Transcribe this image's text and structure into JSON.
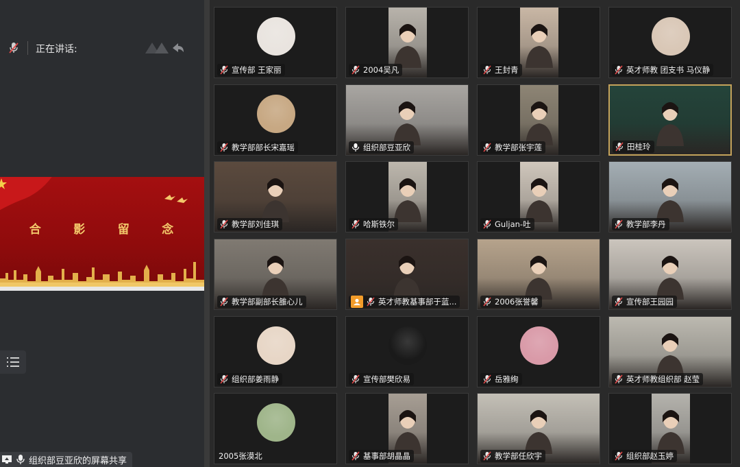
{
  "speaking": {
    "label": "正在讲话:"
  },
  "share_preview": {
    "title_chars": [
      "合",
      "影",
      "留",
      "念"
    ]
  },
  "share_status": {
    "text": "组织部豆亚欣的屏幕共享"
  },
  "colors": {
    "tile_bg": "#1c1c1c",
    "mic_muted": "#e04848",
    "host_badge": "#f39c2a",
    "banner_red": "#a40f10",
    "banner_gold": "#f3c86b"
  },
  "participants": [
    {
      "name": "宣传部 王家丽",
      "mic": "muted",
      "view": "avatar",
      "avatar_color": "#e9e4df"
    },
    {
      "name": "2004吴凡",
      "mic": "muted",
      "view": "video",
      "bg": "#b8b3ab"
    },
    {
      "name": "王封青",
      "mic": "muted",
      "view": "video",
      "bg": "#c9b7a5"
    },
    {
      "name": "英才师教 团支书 马仪静",
      "mic": "muted",
      "view": "avatar",
      "avatar_color": "#d9c7b6"
    },
    {
      "name": "教学部部长宋嘉瑶",
      "mic": "muted",
      "view": "avatar",
      "avatar_color": "#c7a883"
    },
    {
      "name": "组织部豆亚欣",
      "mic": "on",
      "view": "video",
      "bg": "#a9a6a2"
    },
    {
      "name": "教学部张宇莲",
      "mic": "muted",
      "view": "video",
      "bg": "#8e8575"
    },
    {
      "name": "田桂玲",
      "mic": "muted",
      "view": "video",
      "bg": "#24443a",
      "active": true
    },
    {
      "name": "教学部刘佳琪",
      "mic": "muted",
      "view": "video",
      "bg": "#5b4a3e"
    },
    {
      "name": "哈斯铁尔",
      "mic": "muted",
      "view": "video",
      "bg": "#bdb7ad"
    },
    {
      "name": "Guljan-吐",
      "mic": "muted",
      "view": "video",
      "bg": "#d0c7bc"
    },
    {
      "name": "教学部李丹",
      "mic": "muted",
      "view": "video",
      "bg": "#a4aeb4"
    },
    {
      "name": "教学部副部长雒心儿",
      "mic": "muted",
      "view": "video",
      "bg": "#807a72"
    },
    {
      "name": "英才师教基事部于蓝...",
      "mic": "muted",
      "view": "video",
      "bg": "#3a302c",
      "host": true
    },
    {
      "name": "2006张誉馨",
      "mic": "muted",
      "view": "video",
      "bg": "#b6a38c"
    },
    {
      "name": "宣传部王园园",
      "mic": "muted",
      "view": "video",
      "bg": "#cbc5bd"
    },
    {
      "name": "组织部姜雨静",
      "mic": "muted",
      "view": "avatar",
      "avatar_color": "#e7d6c6"
    },
    {
      "name": "宣传部樊欣易",
      "mic": "muted",
      "view": "avatar",
      "avatar_color": "#1a1a1a"
    },
    {
      "name": "岳雅绚",
      "mic": "muted",
      "view": "avatar",
      "avatar_color": "#d99aa8"
    },
    {
      "name": "英才师教组织部 赵莹",
      "mic": "muted",
      "view": "video",
      "bg": "#bcb9b0"
    },
    {
      "name": "2005张漠北",
      "mic": "none",
      "view": "avatar",
      "avatar_color": "#9fb58a"
    },
    {
      "name": "基事部胡晶晶",
      "mic": "muted",
      "view": "video",
      "bg": "#a79e94"
    },
    {
      "name": "教学部任欣宇",
      "mic": "muted",
      "view": "video",
      "bg": "#c4c0b7"
    },
    {
      "name": "组织部赵玉婷",
      "mic": "muted",
      "view": "video",
      "bg": "#b5b3ad"
    }
  ]
}
